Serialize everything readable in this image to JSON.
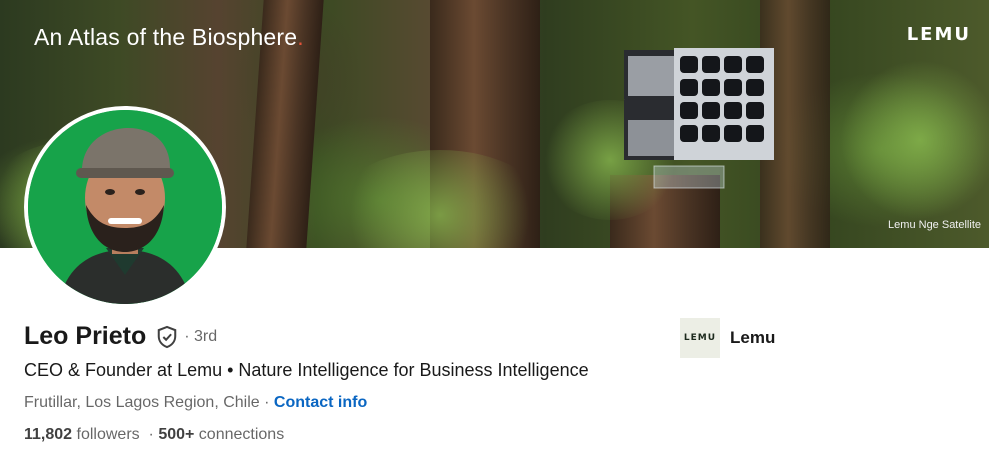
{
  "banner": {
    "title": "An Atlas of the Biosphere",
    "title_accent": ".",
    "brand": "LEMU",
    "caption": "Lemu Nge Satellite"
  },
  "profile": {
    "name": "Leo Prieto",
    "verified_icon": "shield-check-icon",
    "degree": "· 3rd",
    "headline": "CEO & Founder at Lemu • Nature Intelligence for Business Intelligence",
    "location": "Frutillar, Los Lagos Region, Chile",
    "location_separator": " · ",
    "contact_label": "Contact info",
    "followers_count": "11,802",
    "followers_label": " followers",
    "stats_separator": "  · ",
    "connections_count": "500+",
    "connections_label": " connections"
  },
  "company": {
    "logo_text": "LEMU",
    "name": "Lemu"
  },
  "colors": {
    "link": "#0a66c2",
    "avatar_bg": "#17a34a",
    "accent_dot": "#e2533a"
  }
}
